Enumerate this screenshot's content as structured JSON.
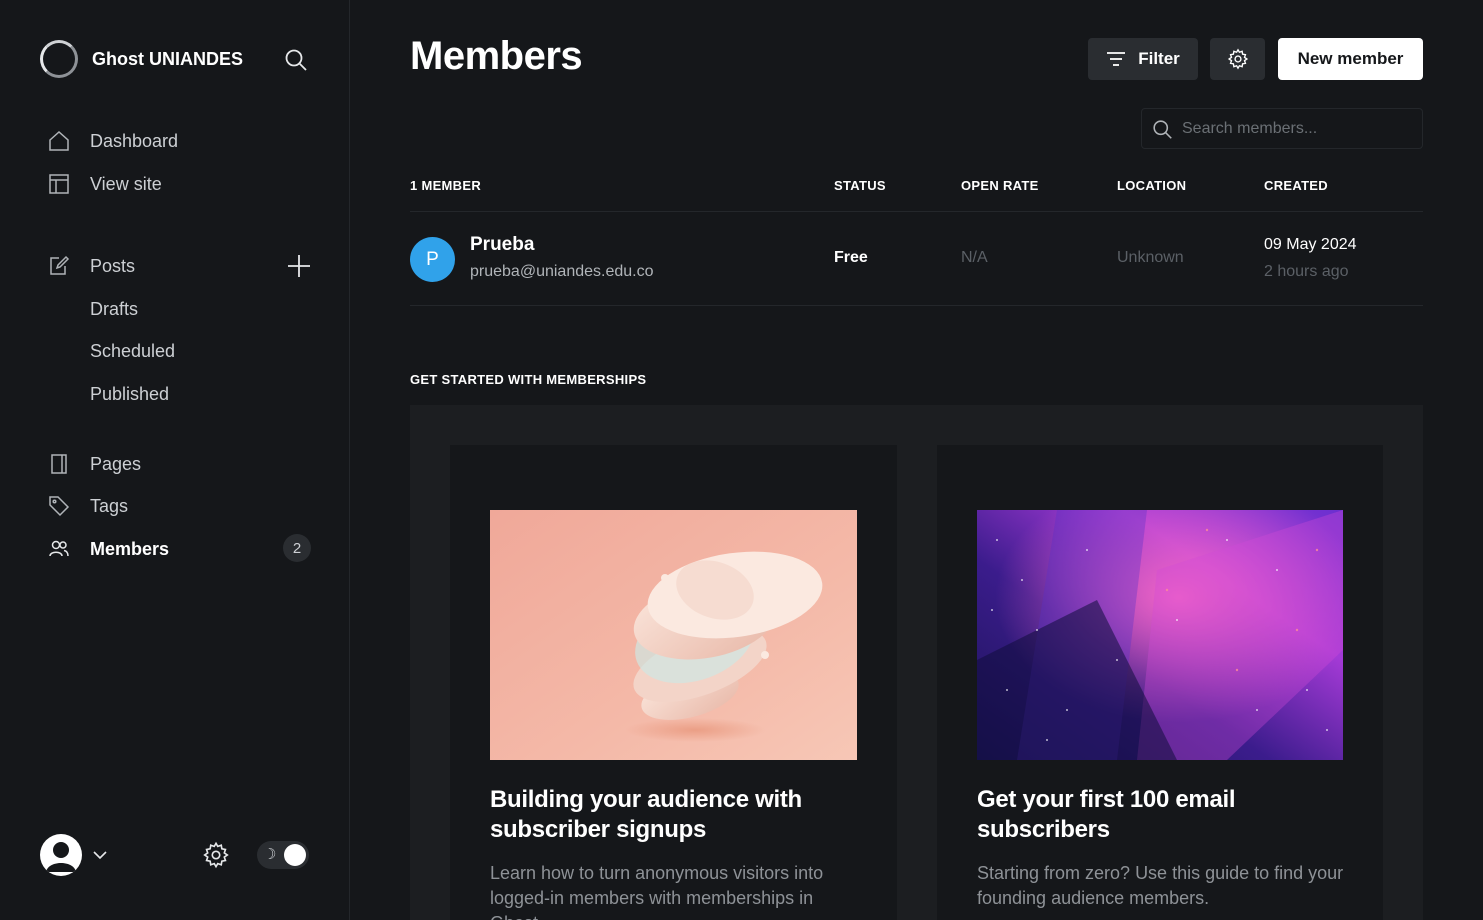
{
  "sidebar": {
    "site_name": "Ghost UNIANDES",
    "nav": {
      "dashboard": "Dashboard",
      "view_site": "View site",
      "posts": "Posts",
      "drafts": "Drafts",
      "scheduled": "Scheduled",
      "published": "Published",
      "pages": "Pages",
      "tags": "Tags",
      "members": "Members",
      "members_count": "2"
    },
    "theme_toggle_icon": "☽"
  },
  "header": {
    "title": "Members",
    "filter_label": "Filter",
    "new_member_label": "New member",
    "search_placeholder": "Search members..."
  },
  "table": {
    "columns": {
      "member": "1 MEMBER",
      "status": "STATUS",
      "open_rate": "OPEN RATE",
      "location": "LOCATION",
      "created": "CREATED"
    },
    "rows": [
      {
        "initial": "P",
        "name": "Prueba",
        "email": "prueba@uniandes.edu.co",
        "status": "Free",
        "open_rate": "N/A",
        "location": "Unknown",
        "created": "09 May 2024",
        "created_ago": "2 hours ago",
        "avatar_color": "#30a2ea"
      }
    ]
  },
  "get_started": {
    "title": "GET STARTED WITH MEMBERSHIPS",
    "cards": [
      {
        "title": "Building your audience with subscriber signups",
        "description": "Learn how to turn anonymous visitors into logged-in members with memberships in Ghost."
      },
      {
        "title": "Get your first 100 email subscribers",
        "description": "Starting from zero? Use this guide to find your founding audience members."
      }
    ]
  },
  "colors": {
    "background": "#15171a",
    "panel": "#1c1e21",
    "accent_avatar": "#30a2ea"
  }
}
